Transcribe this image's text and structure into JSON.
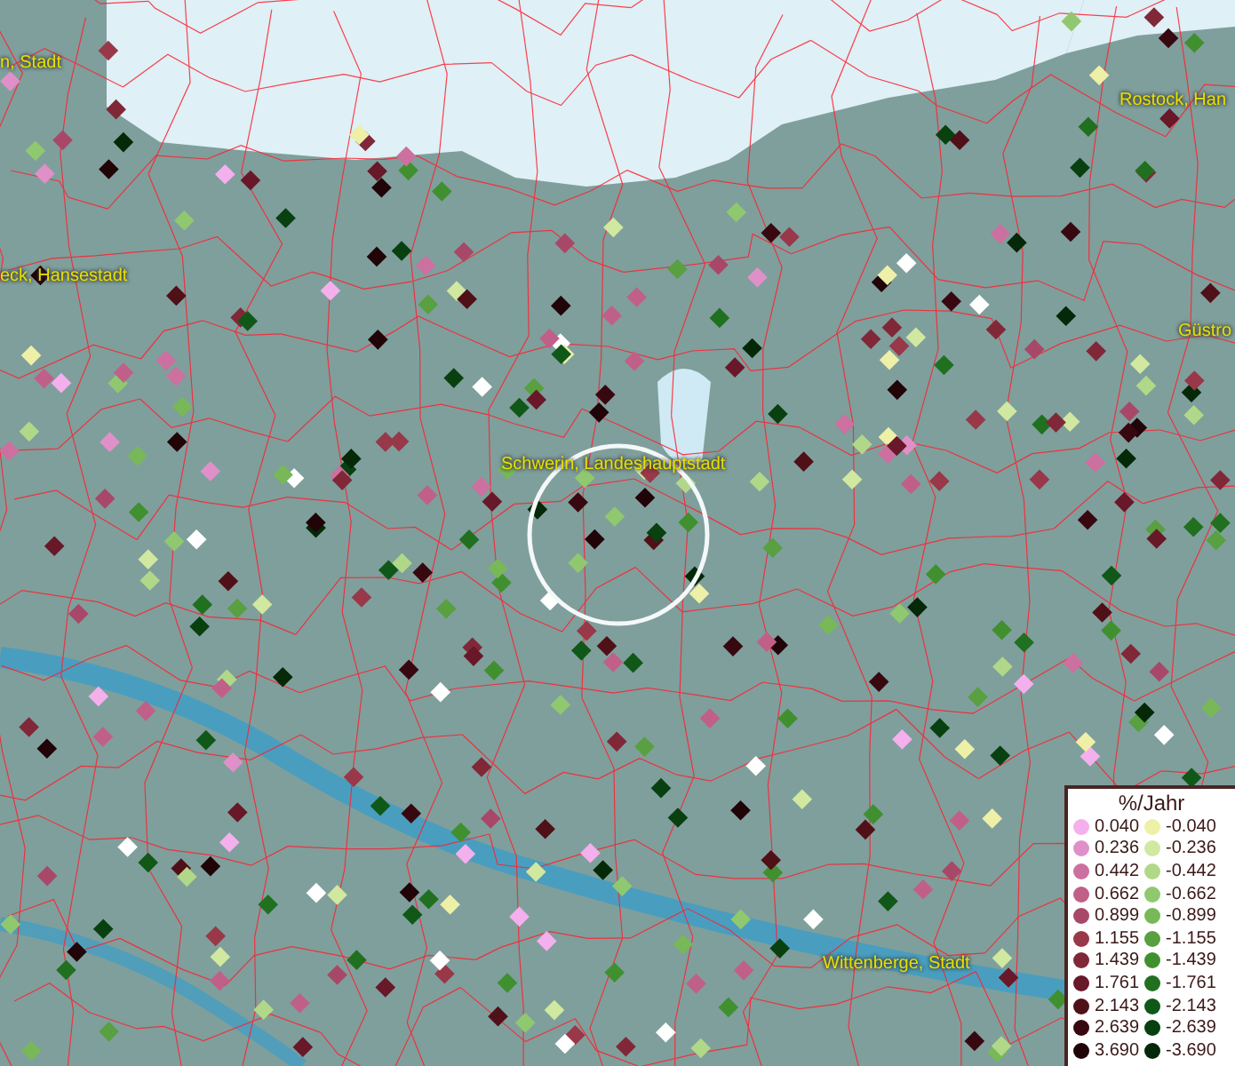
{
  "map": {
    "labels": [
      {
        "text": "n, Stadt"
      },
      {
        "text": "Rostock, Han"
      },
      {
        "text": "eck, Hansestadt"
      },
      {
        "text": "Güstro"
      },
      {
        "text": "Schwerin, Landeshauptstadt"
      },
      {
        "text": "Wittenberge, Stadt"
      }
    ]
  },
  "legend": {
    "title": "%/Jahr",
    "columns": [
      {
        "entries": [
          {
            "label": "0.040",
            "color": "#f4b0ec"
          },
          {
            "label": "0.236",
            "color": "#e090c8"
          },
          {
            "label": "0.442",
            "color": "#cc70a0"
          },
          {
            "label": "0.662",
            "color": "#c06088"
          },
          {
            "label": "0.899",
            "color": "#a84868"
          },
          {
            "label": "1.155",
            "color": "#983848"
          },
          {
            "label": "1.439",
            "color": "#802838"
          },
          {
            "label": "1.761",
            "color": "#681828"
          },
          {
            "label": "2.143",
            "color": "#501018"
          },
          {
            "label": "2.639",
            "color": "#380810"
          },
          {
            "label": "3.690",
            "color": "#200408"
          }
        ]
      },
      {
        "entries": [
          {
            "label": "-0.040",
            "color": "#eef0a8"
          },
          {
            "label": "-0.236",
            "color": "#d0e8a0"
          },
          {
            "label": "-0.442",
            "color": "#b0d888"
          },
          {
            "label": "-0.662",
            "color": "#90c870"
          },
          {
            "label": "-0.899",
            "color": "#78b858"
          },
          {
            "label": "-1.155",
            "color": "#58a040"
          },
          {
            "label": "-1.439",
            "color": "#409030"
          },
          {
            "label": "-1.761",
            "color": "#207020"
          },
          {
            "label": "-2.143",
            "color": "#105818"
          },
          {
            "label": "-2.639",
            "color": "#084010"
          },
          {
            "label": "-3.690",
            "color": "#042808"
          }
        ]
      }
    ]
  }
}
